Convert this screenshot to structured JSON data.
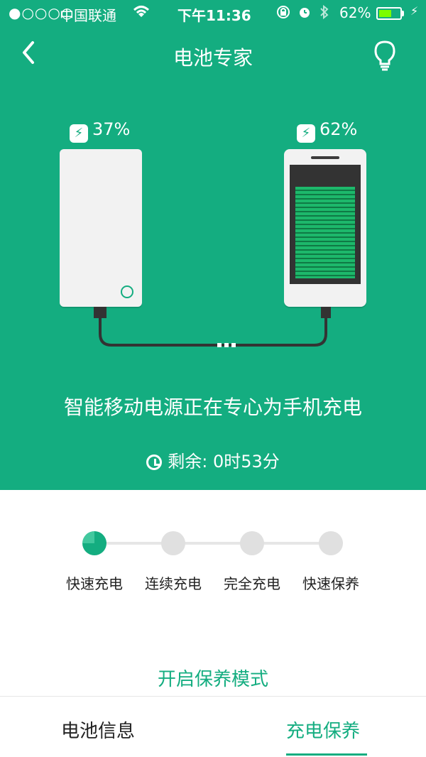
{
  "status_bar": {
    "signal": "●○○○○",
    "carrier": "中国联通",
    "time": "下午11:36",
    "battery_percent": "62%",
    "battery_level": 0.62
  },
  "nav": {
    "title": "电池专家",
    "back_icon": "chevron-left-icon",
    "right_icon": "lightbulb-icon"
  },
  "devices": {
    "powerbank_percent": "37%",
    "phone_percent": "62%",
    "phone_level": 0.62
  },
  "message": "智能移动电源正在专心为手机充电",
  "remaining": "剩余: 0时53分",
  "steps": [
    {
      "label": "快速充电",
      "active": true
    },
    {
      "label": "连续充电",
      "active": false
    },
    {
      "label": "完全充电",
      "active": false
    },
    {
      "label": "快速保养",
      "active": false
    }
  ],
  "action": "开启保养模式",
  "tabs": [
    {
      "label": "电池信息",
      "selected": false
    },
    {
      "label": "充电保养",
      "selected": true
    }
  ],
  "colors": {
    "brand": "#14ad80",
    "battery_fill": "#7CFC00"
  }
}
